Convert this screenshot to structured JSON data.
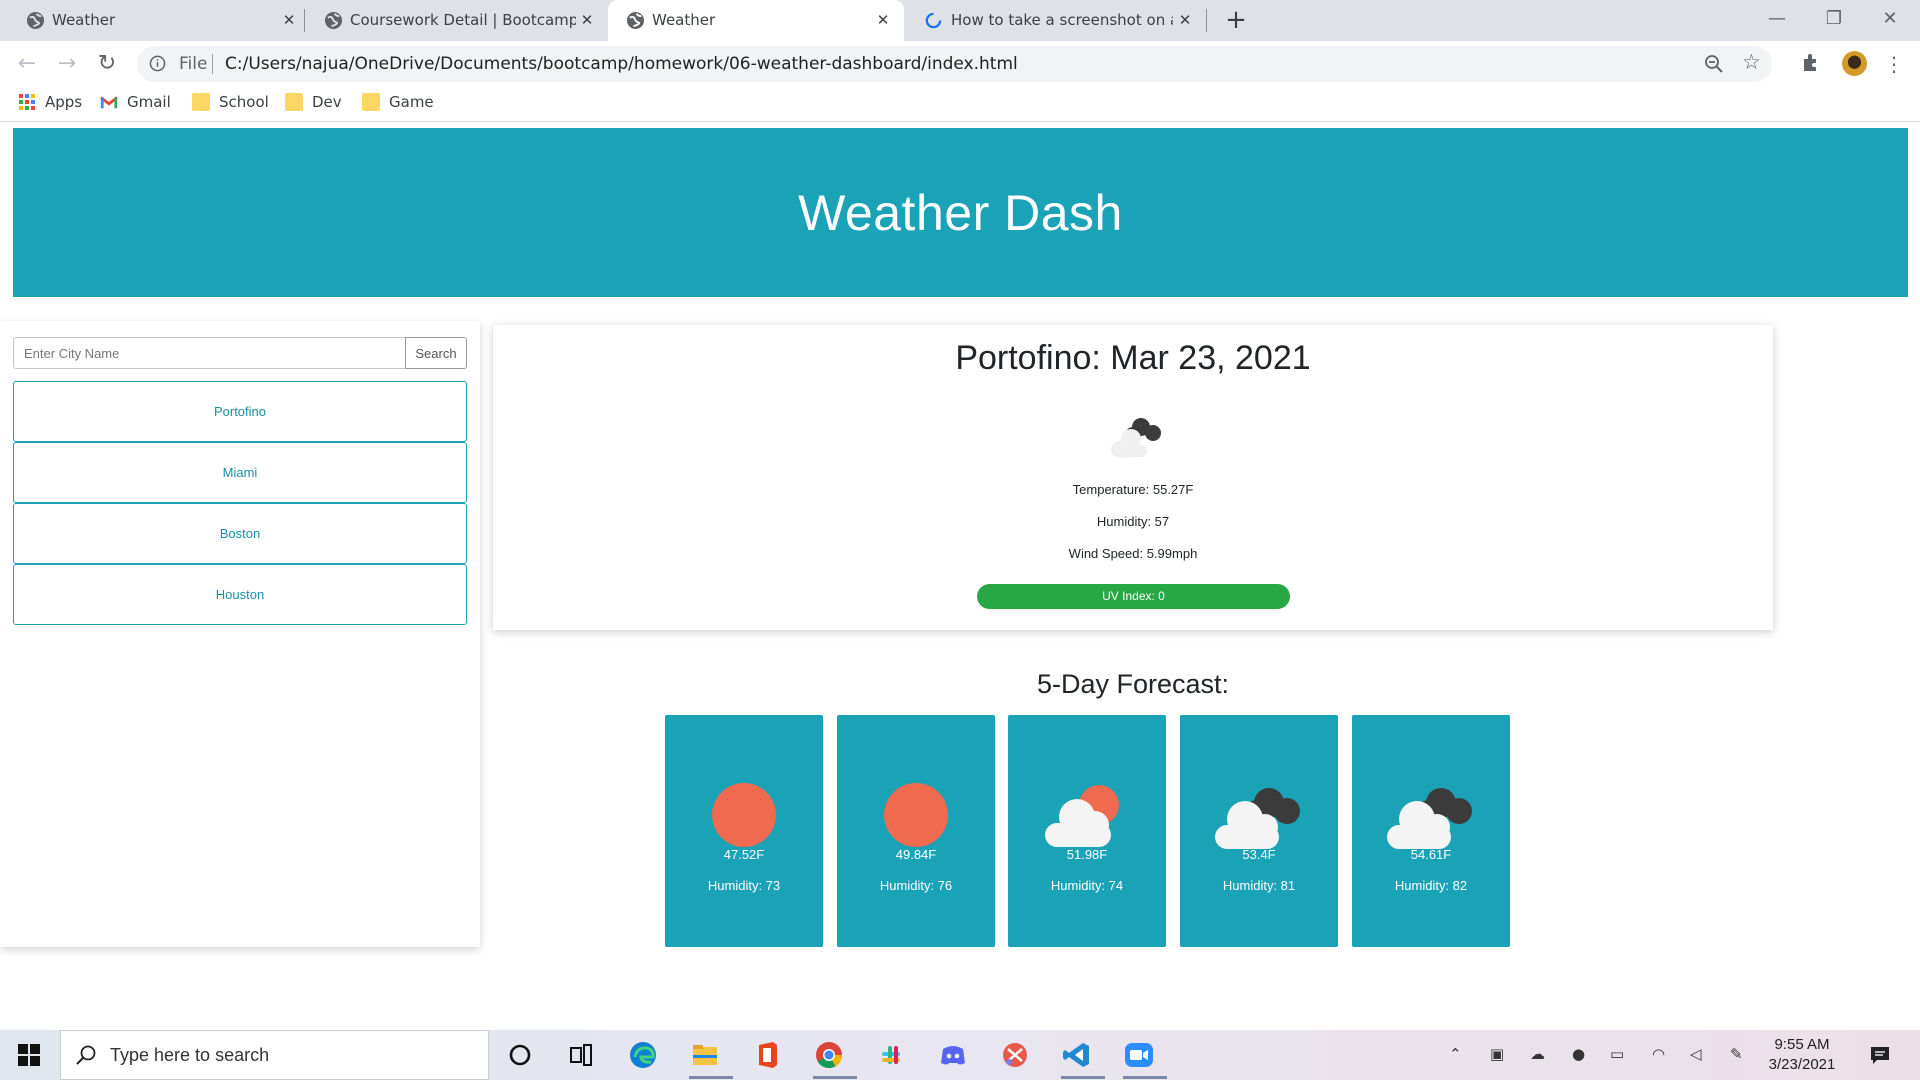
{
  "browser": {
    "tabs": [
      {
        "title": "Weather",
        "active": false
      },
      {
        "title": "Coursework Detail | Bootcamp Sp",
        "active": false
      },
      {
        "title": "Weather",
        "active": true
      },
      {
        "title": "How to take a screenshot on any",
        "active": false
      }
    ],
    "address": {
      "scheme_label": "File",
      "url": "C:/Users/najua/OneDrive/Documents/bootcamp/homework/06-weather-dashboard/index.html"
    },
    "bookmarks": [
      {
        "label": "Apps",
        "icon": "apps-grid-icon"
      },
      {
        "label": "Gmail",
        "icon": "gmail-icon"
      },
      {
        "label": "School",
        "icon": "folder-icon"
      },
      {
        "label": "Dev",
        "icon": "folder-icon"
      },
      {
        "label": "Game",
        "icon": "folder-icon"
      }
    ]
  },
  "app": {
    "header_title": "Weather Dash",
    "search": {
      "placeholder": "Enter City Name",
      "value": "",
      "button_label": "Search"
    },
    "history": [
      "Portofino",
      "Miami",
      "Boston",
      "Houston"
    ],
    "current": {
      "heading": "Portofino: Mar 23, 2021",
      "icon": "cloudy-icon",
      "temperature": "Temperature: 55.27F",
      "humidity": "Humidity: 57",
      "wind": "Wind Speed: 5.99mph",
      "uv": "UV Index: 0",
      "uv_color": "#28a745"
    },
    "forecast_title": "5-Day Forecast:",
    "forecast": [
      {
        "icon": "sun-icon",
        "temp": "47.52F",
        "humidity": "Humidity: 73"
      },
      {
        "icon": "sun-icon",
        "temp": "49.84F",
        "humidity": "Humidity: 76"
      },
      {
        "icon": "partly-cloudy-icon",
        "temp": "51.98F",
        "humidity": "Humidity: 74"
      },
      {
        "icon": "cloudy-icon",
        "temp": "53.4F",
        "humidity": "Humidity: 81"
      },
      {
        "icon": "cloudy-icon",
        "temp": "54.61F",
        "humidity": "Humidity: 82"
      }
    ],
    "accent_color": "#1aa2b7"
  },
  "taskbar": {
    "search_placeholder": "Type here to search",
    "apps": [
      "cortana-icon",
      "task-view-icon",
      "edge-icon",
      "file-explorer-icon",
      "office-icon",
      "chrome-icon",
      "slack-icon",
      "discord-icon",
      "snip-icon",
      "vscode-icon",
      "zoom-icon"
    ],
    "time": "9:55 AM",
    "date": "3/23/2021"
  }
}
